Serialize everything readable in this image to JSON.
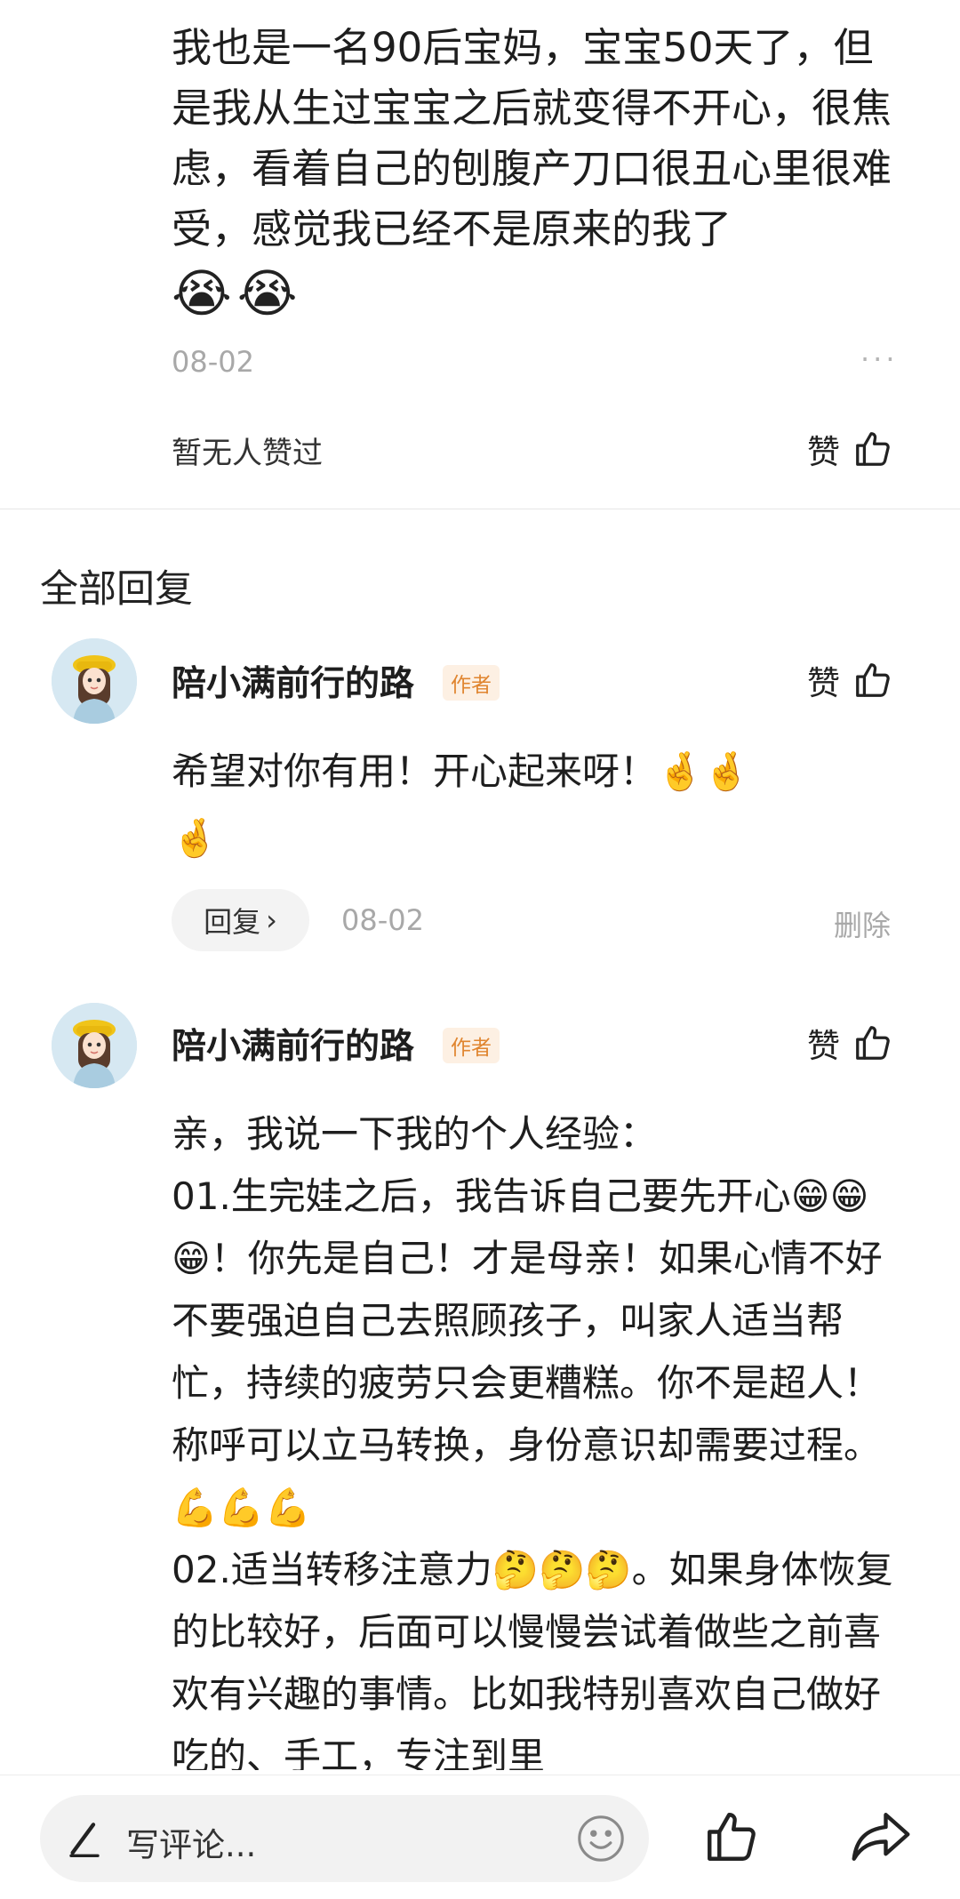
{
  "post": {
    "text": "我也是一名90后宝妈，宝宝50天了，但是我从生过宝宝之后就变得不开心，很焦虑，看着自己的刨腹产刀口很丑心里很难受，感觉我已经不是原来的我了",
    "emojis": [
      "😭",
      "😭"
    ],
    "date": "08-02",
    "more": "···",
    "likes_text": "暂无人赞过",
    "like_label": "赞"
  },
  "replies_header": "全部回复",
  "replies": [
    {
      "author": "陪小满前行的路",
      "badge": "作者",
      "like_label": "赞",
      "line1": "希望对你有用！开心起来呀！🤞🤞",
      "line2": "🤞",
      "reply_label": "回复",
      "reply_chevron": "›",
      "date": "08-02",
      "delete_label": "删除"
    },
    {
      "author": "陪小满前行的路",
      "badge": "作者",
      "like_label": "赞",
      "text": "亲，我说一下我的个人经验：\n01.生完娃之后，我告诉自己要先开心😁😁😁！你先是自己！才是母亲！如果心情不好不要强迫自己去照顾孩子，叫家人适当帮忙，持续的疲劳只会更糟糕。你不是超人！称呼可以立马转换，身份意识却需要过程。💪💪💪\n02.适当转移注意力🤔🤔🤔。如果身体恢复的比较好，后面可以慢慢尝试着做些之前喜欢有兴趣的事情。比如我特别喜欢自己做好吃的、手工，专注到里"
    }
  ],
  "bottom_bar": {
    "placeholder": "写评论...",
    "icons": [
      "pen-icon",
      "smile-icon",
      "thumb-up-icon",
      "share-icon"
    ]
  }
}
